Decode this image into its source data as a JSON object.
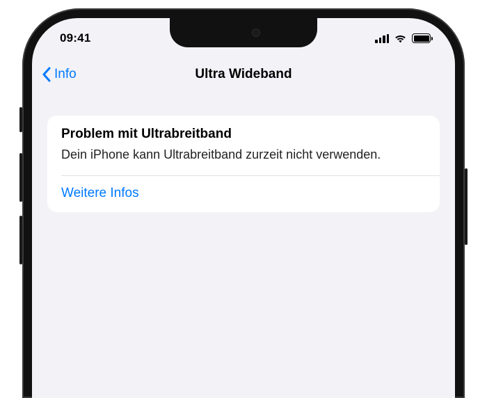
{
  "status": {
    "time": "09:41"
  },
  "nav": {
    "back_label": "Info",
    "title": "Ultra Wideband"
  },
  "card": {
    "title": "Problem mit Ultrabreitband",
    "body": "Dein iPhone kann Ultrabreitband zurzeit nicht verwenden.",
    "link": "Weitere Infos"
  }
}
